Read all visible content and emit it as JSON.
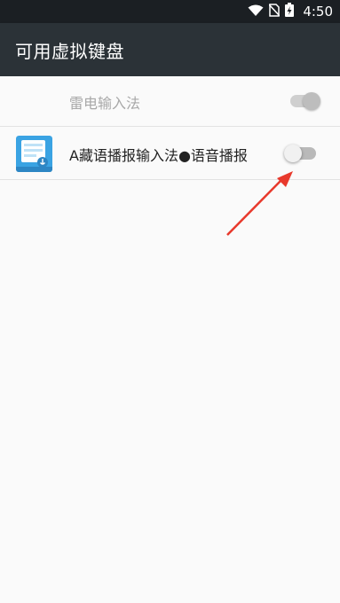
{
  "status_bar": {
    "time": "4:50",
    "icons": [
      "wifi-icon",
      "no-sim-icon",
      "battery-charging-icon"
    ]
  },
  "app_bar": {
    "title": "可用虚拟键盘"
  },
  "keyboards": [
    {
      "label": "雷电输入法",
      "enabled": true,
      "disabled_appearance": true
    },
    {
      "label": "A藏语播报输入法●语音播报",
      "enabled": false,
      "icon": "keyboard-app-icon"
    }
  ],
  "annotation": {
    "icon": "red-arrow-icon",
    "color": "#e8392c"
  },
  "colors": {
    "statusbar": "#1b1f23",
    "appbar": "#2b3237",
    "background": "#fafafa"
  }
}
